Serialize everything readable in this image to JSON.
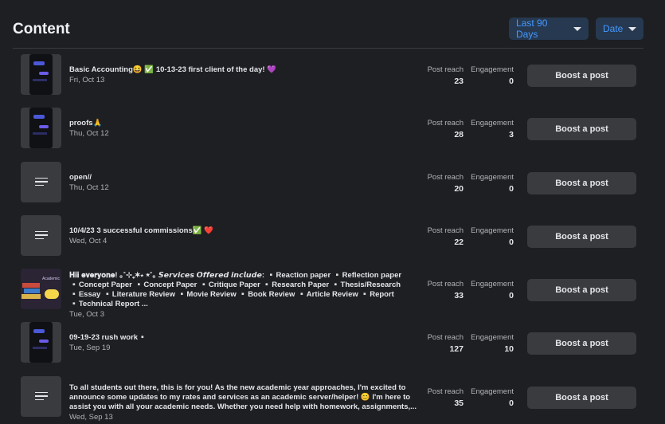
{
  "header": {
    "title": "Content",
    "range_label": "Last 90 Days",
    "sort_label": "Date"
  },
  "columns": {
    "reach": "Post reach",
    "engagement": "Engagement"
  },
  "boost_label": "Boost a post",
  "posts": [
    {
      "thumb": "phone-screenshot",
      "text": "Basic Accounting😆 ✅ 10-13-23 first client of the day! 💜",
      "date": "Fri, Oct 13",
      "reach": "23",
      "engagement": "0"
    },
    {
      "thumb": "phone-screenshot",
      "text": "proofs🙏",
      "date": "Thu, Oct 12",
      "reach": "28",
      "engagement": "3"
    },
    {
      "thumb": "text-post",
      "text": "open//",
      "date": "Thu, Oct 12",
      "reach": "20",
      "engagement": "0"
    },
    {
      "thumb": "text-post",
      "text": "10/4/23 3 successful commissions✅ ❤️",
      "date": "Wed, Oct 4",
      "reach": "22",
      "engagement": "0"
    },
    {
      "thumb": "academic-image",
      "thumb_caption": "Academic",
      "text": "𝐇𝐢𝐢 𝐞𝐯𝐞𝐫𝐲𝐨𝐧𝐞! ｡˚⊹₊✶⋆ ⭒˚｡ 𝙎𝙚𝙧𝙫𝙞𝙘𝙚𝙨 𝙊𝙛𝙛𝙚𝙧𝙚𝙙 𝙞𝙣𝙘𝙡𝙪𝙙𝙚: ▫️Reaction paper ▫️Reflection paper ▫️Concept Paper ▫️Concept Paper ▫️Critique Paper ▫️Research Paper ▫️Thesis/Research ▫️Essay ▫️Literature Review ▫️Movie Review ▫️Book Review ▫️Article Review ▫️Report ▫️Technical Report ...",
      "date": "Tue, Oct 3",
      "reach": "33",
      "engagement": "0"
    },
    {
      "thumb": "phone-screenshot",
      "text": "09-19-23 rush work▫️",
      "date": "Tue, Sep 19",
      "reach": "127",
      "engagement": "10"
    },
    {
      "thumb": "text-post",
      "text": "To all students out there, this is for you! As the new academic year approaches, I'm excited to announce some updates to my rates and services as an academic server/helper! 😊 I'm here to assist you with all your academic needs. Whether you need help with homework, assignments,...",
      "date": "Wed, Sep 13",
      "reach": "35",
      "engagement": "0"
    }
  ]
}
